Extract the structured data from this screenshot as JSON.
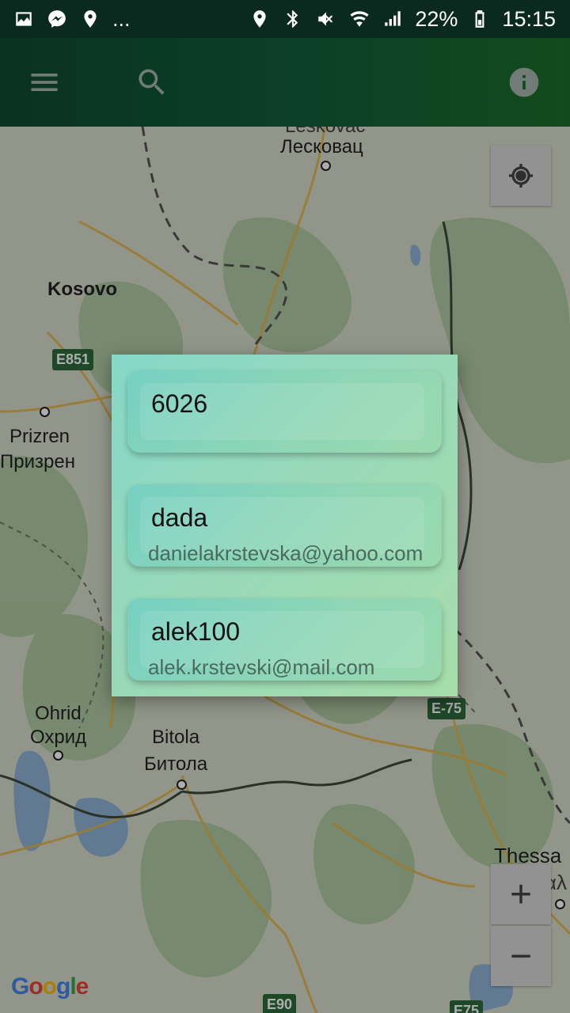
{
  "status_bar": {
    "left_icons": [
      "image-icon",
      "messenger-icon",
      "location-pin-icon"
    ],
    "overflow": "...",
    "right_icons": [
      "location-icon",
      "bluetooth-icon",
      "mute-icon",
      "wifi-icon",
      "signal-icon"
    ],
    "battery_percent": "22%",
    "time": "15:15"
  },
  "app_bar": {
    "menu_icon": "hamburger-menu-icon",
    "search_icon": "search-icon",
    "info_icon": "info-icon"
  },
  "map": {
    "labels": {
      "leskovac_latin": "Leskovac",
      "leskovac_cyr": "Лесковац",
      "kosovo": "Kosovo",
      "prizren_latin": "Prizren",
      "prizren_cyr": "Призрен",
      "ohrid_latin": "Ohrid",
      "ohrid_cyr": "Охрид",
      "bitola_latin": "Bitola",
      "bitola_cyr": "Битола",
      "thessaloniki_latin": "Thessa",
      "thessaloniki_greek": "Θεσσαλ"
    },
    "road_signs": {
      "e851": "E851",
      "e75": "E-75",
      "e90": "E90",
      "e75b": "E75"
    },
    "controls": {
      "my_location_icon": "my-location-icon",
      "zoom_in": "+",
      "zoom_out": "−"
    },
    "attribution": [
      "G",
      "o",
      "o",
      "g",
      "l",
      "e"
    ]
  },
  "dialog": {
    "items": [
      {
        "name": "6026",
        "email": ""
      },
      {
        "name": "dada",
        "email": "danielakrstevska@yahoo.com"
      },
      {
        "name": "alek100",
        "email": "alek.krstevski@mail.com"
      }
    ]
  }
}
